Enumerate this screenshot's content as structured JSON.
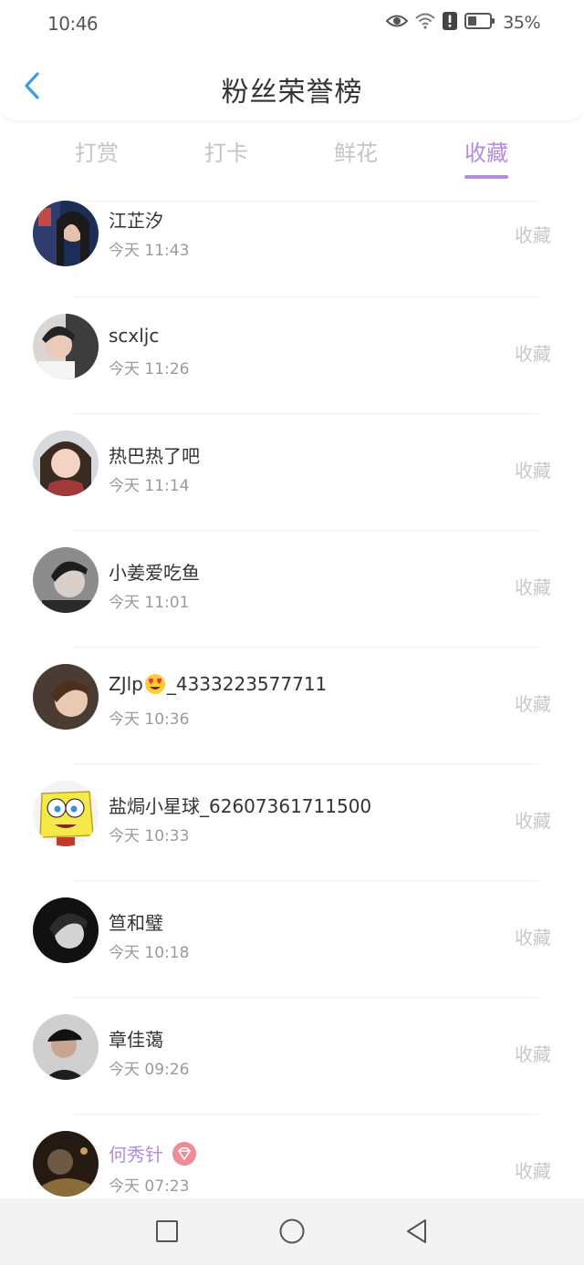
{
  "status_bar": {
    "time": "10:46",
    "battery_percent": "35%",
    "icons": [
      "eye-icon",
      "wifi-icon",
      "alert-icon",
      "battery-icon"
    ]
  },
  "header": {
    "title": "粉丝荣誉榜",
    "back_icon": "chevron-left-icon"
  },
  "tabs": [
    {
      "label": "打赏",
      "active": false
    },
    {
      "label": "打卡",
      "active": false
    },
    {
      "label": "鲜花",
      "active": false
    },
    {
      "label": "收藏",
      "active": true
    }
  ],
  "colors": {
    "accent": "#b48be0",
    "badge": "#f08a94"
  },
  "fans": [
    {
      "name": "江芷汐",
      "time": "今天 11:43",
      "action": "收藏",
      "avatar": "avatar-1"
    },
    {
      "name": "scxljc",
      "time": "今天 11:26",
      "action": "收藏",
      "avatar": "avatar-2"
    },
    {
      "name": "热巴热了吧",
      "time": "今天 11:14",
      "action": "收藏",
      "avatar": "avatar-3"
    },
    {
      "name": "小姜爱吃鱼",
      "time": "今天 11:01",
      "action": "收藏",
      "avatar": "avatar-4"
    },
    {
      "name_prefix": "ZJlp",
      "name_suffix": "_4333223577711",
      "emoji": "heart-eyes-emoji-icon",
      "time": "今天 10:36",
      "action": "收藏",
      "avatar": "avatar-5"
    },
    {
      "name": "盐焗小星球_62607361711500",
      "time": "今天 10:33",
      "action": "收藏",
      "avatar": "spongebob-avatar"
    },
    {
      "name": "笪和璧",
      "time": "今天 10:18",
      "action": "收藏",
      "avatar": "avatar-7"
    },
    {
      "name": "章佳蔼",
      "time": "今天 09:26",
      "action": "收藏",
      "avatar": "avatar-8"
    },
    {
      "name": "何秀针",
      "vip": true,
      "badge": "diamond-badge-icon",
      "time": "今天 07:23",
      "action": "收藏",
      "avatar": "avatar-9"
    }
  ],
  "nav_bar": {
    "buttons": [
      "recent-apps-icon",
      "home-icon",
      "back-triangle-icon"
    ]
  }
}
